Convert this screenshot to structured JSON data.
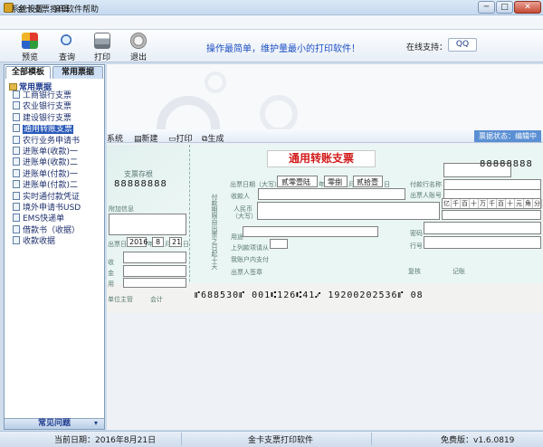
{
  "window": {
    "title": "金卡支票打印软件",
    "min": "─",
    "max": "□",
    "close": "✕"
  },
  "menu": [
    "系统设置",
    "编辑",
    "帮助"
  ],
  "toolbar": {
    "buttons": [
      "预览",
      "查询",
      "打印",
      "退出"
    ],
    "slogan": "操作最简单，维护量最小的打印软件！",
    "online_label": "在线支持：",
    "qq": "QQ"
  },
  "tabs": [
    "全部模板",
    "常用票据"
  ],
  "tree": {
    "root": "常用票据",
    "items": [
      "工商银行支票",
      "农业银行支票",
      "建设银行支票",
      "通用转账支票",
      "农行业务申请书",
      "进账单(收款)一",
      "进账单(收款)二",
      "进账单(付款)一",
      "进账单(付款)二",
      "实时通付款凭证",
      "境外申请书USD",
      "EMS快递单",
      "借款书（收据）",
      "收款收据"
    ],
    "selected_index": 3
  },
  "faq": "常见问题",
  "subtoolbar": {
    "system": "系统",
    "new": "新建",
    "print": "打印",
    "generate": "生成",
    "status": "票据状态：编辑中"
  },
  "cheque": {
    "title": "通用转账支票",
    "stub_title": "支票存根",
    "stub_number": "88888888",
    "number": "88888888",
    "date_big_year": "贰零壹陆",
    "date_big_month": "零捌",
    "date_big_day": "贰拾壹",
    "stub_year": "2016",
    "stub_month": "8",
    "stub_day": "21",
    "micr": "⑈688530⑈ 001⑆126⑆41⑇   19200202536⑈ 08",
    "grid": [
      "亿",
      "千",
      "百",
      "十",
      "万",
      "千",
      "百",
      "十",
      "元",
      "角",
      "分"
    ],
    "labels": {
      "date_label": "出票日期（大写）",
      "year": "年",
      "month": "月",
      "day": "日",
      "payee": "收款人",
      "bank_name": "付款行名称",
      "account": "出票人账号",
      "amount_rmb": "人民币",
      "amount_caps": "（大写）",
      "purpose": "用途",
      "password": "密码",
      "line_no": "行号",
      "above_amount": "上列款项请从",
      "my_account": "我账户内支付",
      "drawer_seal": "出票人签章",
      "review": "复核",
      "bookkeep": "记账",
      "stub_extra": "附加信息",
      "stub_date": "出票日期",
      "stub_payee": "收",
      "stub_amount": "金",
      "stub_use": "用",
      "manager": "单位主管",
      "accountant": "会计",
      "side_note": "付款期限自出票之日起十天"
    }
  },
  "statusbar": {
    "date": "当前日期：2016年8月21日",
    "app": "金卡支票打印软件",
    "version": "免费版：v1.6.0819"
  }
}
